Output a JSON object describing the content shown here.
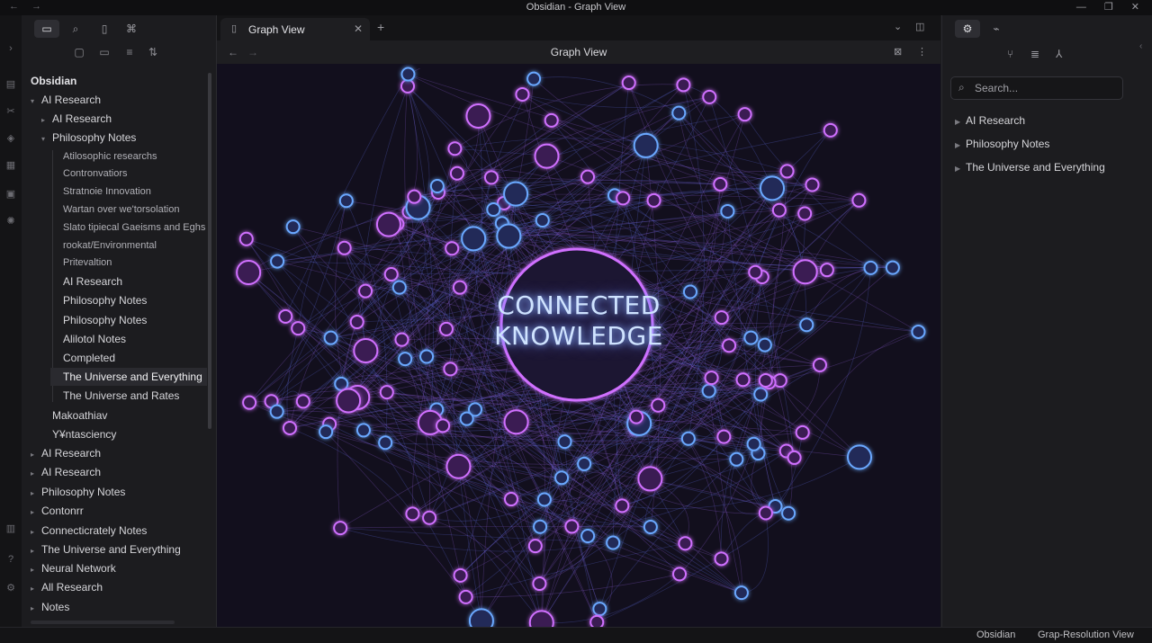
{
  "window": {
    "title": "Obsidian - Graph View"
  },
  "sidebar": {
    "vault_name": "Obsidian",
    "tree": [
      {
        "label": "AI Research",
        "level": 0,
        "arrow": "open"
      },
      {
        "label": "AI Research",
        "level": 1,
        "arrow": "closed"
      },
      {
        "label": "Philosophy Notes",
        "level": 1,
        "arrow": "open"
      },
      {
        "label": "Atilosophic researchs",
        "level": 2,
        "arrow": "none"
      },
      {
        "label": "Contronvatiors",
        "level": 2,
        "arrow": "none"
      },
      {
        "label": "Stratnoie Innovation",
        "level": 2,
        "arrow": "none"
      },
      {
        "label": "Wartan over we'torsolation",
        "level": 2,
        "arrow": "none"
      },
      {
        "label": "Slato tipiecal Gaeisms and Eghs",
        "level": 2,
        "arrow": "none"
      },
      {
        "label": "rookat/Environmental",
        "level": 2,
        "arrow": "none"
      },
      {
        "label": "Pritevaltion",
        "level": 2,
        "arrow": "none"
      },
      {
        "label": "AI Research",
        "level": 2,
        "arrow": "none"
      },
      {
        "label": "Philosophy Notes",
        "level": 2,
        "arrow": "none"
      },
      {
        "label": "Philosophy Notes",
        "level": 2,
        "arrow": "none"
      },
      {
        "label": "Alilotol Notes",
        "level": 2,
        "arrow": "none"
      },
      {
        "label": "Completed",
        "level": 2,
        "arrow": "none"
      },
      {
        "label": "The Universe and Everything",
        "level": 2,
        "arrow": "none",
        "selected": true
      },
      {
        "label": "The Universe and Rates",
        "level": 2,
        "arrow": "none"
      },
      {
        "label": "Makoathiav",
        "level": 1,
        "arrow": "none"
      },
      {
        "label": "Y¥ntasciency",
        "level": 1,
        "arrow": "none"
      },
      {
        "label": "AI Research",
        "level": 0,
        "arrow": "closed"
      },
      {
        "label": "AI Research",
        "level": 0,
        "arrow": "closed"
      },
      {
        "label": "Philosophy Notes",
        "level": 0,
        "arrow": "closed"
      },
      {
        "label": "Contonrr",
        "level": 0,
        "arrow": "closed"
      },
      {
        "label": "Connecticrately Notes",
        "level": 0,
        "arrow": "closed"
      },
      {
        "label": "The Universe and Everything",
        "level": 0,
        "arrow": "closed"
      },
      {
        "label": "Neural Network",
        "level": 0,
        "arrow": "closed"
      },
      {
        "label": "All Research",
        "level": 0,
        "arrow": "closed"
      },
      {
        "label": "Notes",
        "level": 0,
        "arrow": "closed"
      }
    ]
  },
  "center": {
    "tab_label": "Graph View",
    "view_title": "Graph View",
    "hero_line1": "CONNECTED",
    "hero_line2": "KNOWLEDGE"
  },
  "right_panel": {
    "search_placeholder": "Search...",
    "items": [
      "AI Research",
      "Philosophy Notes",
      "The Universe and Everything"
    ]
  },
  "statusbar": {
    "left": "Obsidian",
    "right": "Grap-Resolution View"
  },
  "colors": {
    "accent_purple": "#d070ff",
    "accent_blue": "#6aa8ff",
    "graph_bg": "#120f1d"
  },
  "icons": [
    "folder-icon",
    "search-icon",
    "bookmark-icon",
    "graph-icon",
    "new-note-icon",
    "new-folder-icon",
    "sort-icon",
    "collapse-icon",
    "settings-icon",
    "help-icon"
  ]
}
